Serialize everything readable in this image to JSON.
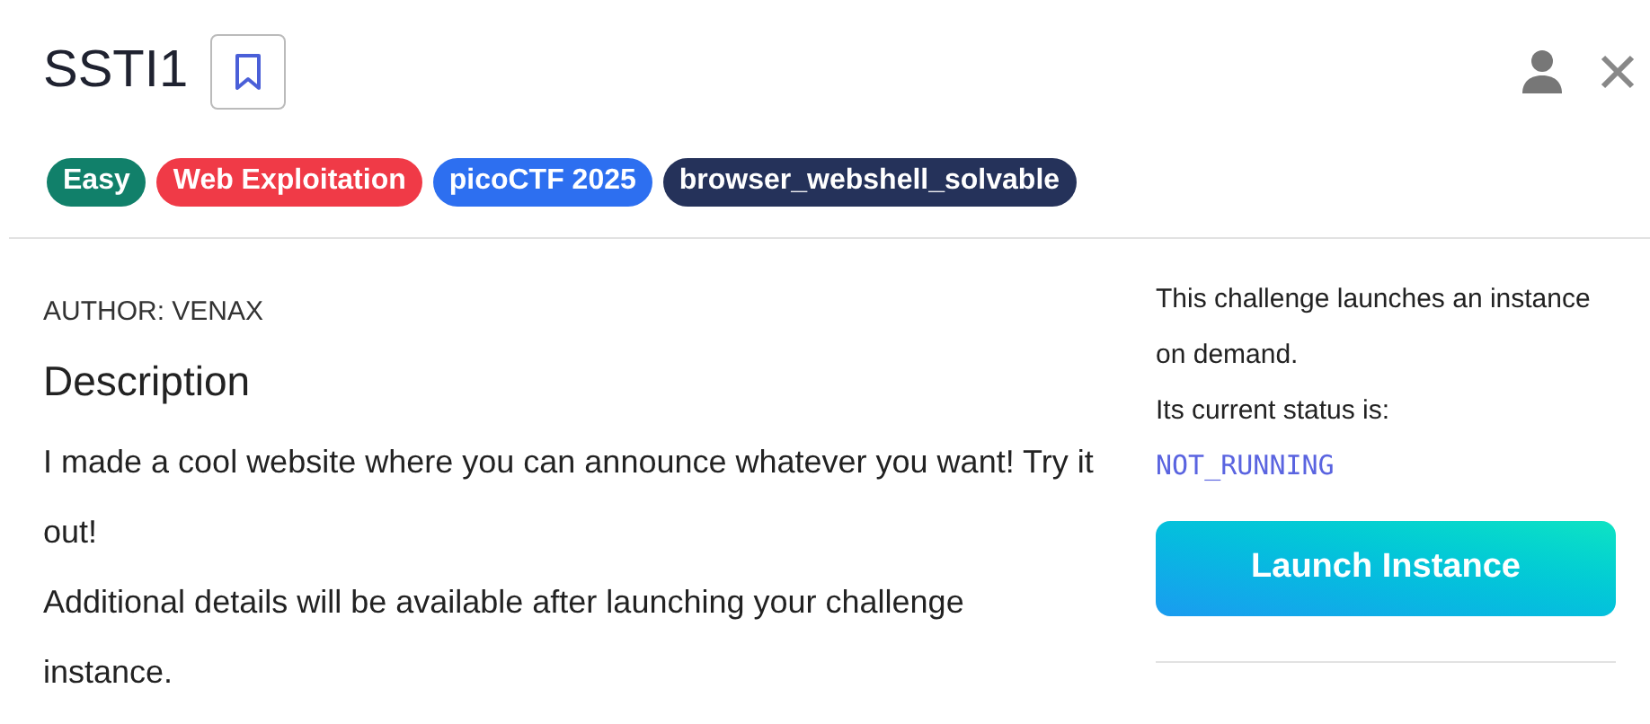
{
  "header": {
    "title": "SSTI1"
  },
  "tags": [
    {
      "label": "Easy",
      "color": "#11806a"
    },
    {
      "label": "Web Exploitation",
      "color": "#f03a47"
    },
    {
      "label": "picoCTF 2025",
      "color": "#2d6ff0"
    },
    {
      "label": "browser_webshell_solvable",
      "color": "#25325a"
    }
  ],
  "challenge": {
    "author": "AUTHOR: VENAX",
    "heading": "Description",
    "paragraphs": [
      "I made a cool website where you can announce whatever you want! Try it out!",
      "Additional details will be available after launching your challenge instance."
    ]
  },
  "instance": {
    "lines": [
      "This challenge launches an instance on demand.",
      "Its current status is:"
    ],
    "status": "NOT_RUNNING",
    "button": "Launch Instance"
  }
}
